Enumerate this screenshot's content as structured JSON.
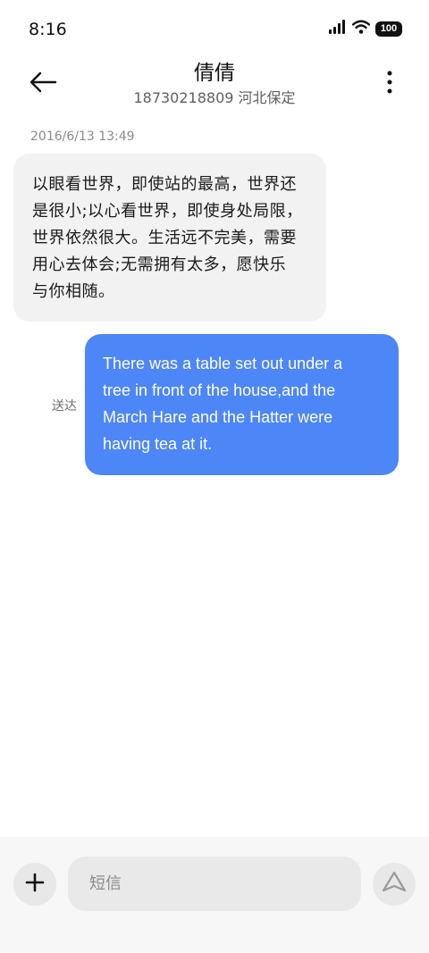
{
  "status_bar": {
    "time": "8:16",
    "battery": "100",
    "icons": [
      "signal-icon",
      "wifi-icon",
      "battery-icon"
    ]
  },
  "header": {
    "name": "倩倩",
    "subtitle": "18730218809 河北保定",
    "icons": [
      "back-arrow-icon",
      "more-vertical-icon"
    ]
  },
  "messages": {
    "timestamp": "2016/6/13 13:49",
    "incoming": {
      "lines": [
        "以眼看世界，即使站的最高，世界还",
        "是很小;以心看世界，即使身处局限，",
        "世界依然很大。生活远不完美，需要",
        "用心去体会;无需拥有太多，愿快乐",
        "与你相随。"
      ]
    },
    "outgoing": {
      "lines": [
        "There was a table set out under a",
        "tree in front of the house,and the",
        "March Hare and the Hatter were",
        "having tea at it."
      ],
      "status": "送达"
    }
  },
  "input_bar": {
    "placeholder": "短信",
    "value": "",
    "icons": [
      "plus-icon",
      "send-icon"
    ]
  },
  "colors": {
    "outgoing_bubble": "#4d86f7",
    "incoming_bubble": "#f2f2f2",
    "background": "#ffffff",
    "input_bar": "#f7f7f7"
  }
}
